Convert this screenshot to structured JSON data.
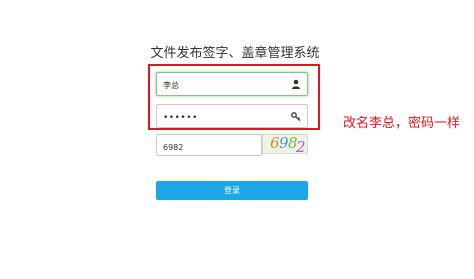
{
  "page": {
    "title": "文件发布签字、盖章管理系统"
  },
  "form": {
    "username_value": "李总",
    "password_value": "••••••",
    "captcha_value": "6982",
    "captcha_image_text": "6982",
    "login_label": "登录"
  },
  "annotation": {
    "text": "改名李总，密码一样"
  },
  "icons": {
    "username": "user-icon",
    "password": "key-icon"
  },
  "colors": {
    "button": "#1ca7e8",
    "highlight": "#e8141b",
    "active_border": "#7fc87f"
  }
}
